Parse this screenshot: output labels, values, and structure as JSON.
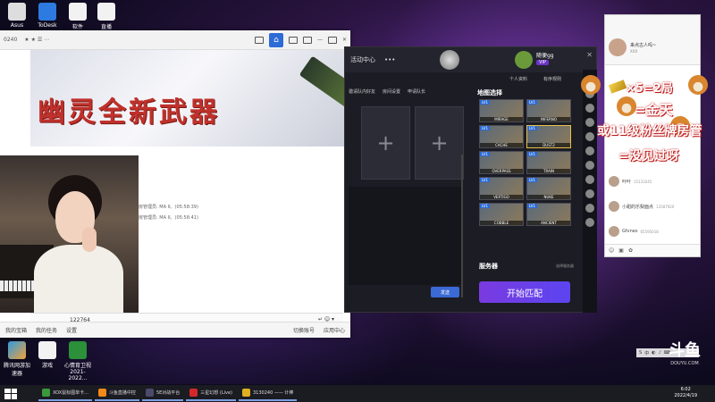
{
  "desktop": {
    "icons": [
      {
        "label": "Asus"
      },
      {
        "label": "ToDesk"
      },
      {
        "label": "软件"
      },
      {
        "label": "直播"
      },
      {
        "label": "腾讯网游加速器"
      },
      {
        "label": "游戏"
      },
      {
        "label": "心情育卫视\n2021-2022..."
      }
    ]
  },
  "browser": {
    "tab_text": "0240",
    "banner_title": "幽灵全新武器",
    "chat_lines": [
      "房管理员: MA II。(05:58:39)",
      "房管理员: MA II。(05:58:41)"
    ],
    "input_value": "122764",
    "bottom_items": [
      "我的宝箱",
      "我的任务",
      "设置"
    ],
    "bottom_right": [
      "切换账号",
      "应用中心"
    ]
  },
  "game": {
    "menu_label": "活动中心",
    "user_name": "随便gg",
    "vip": "VIP",
    "buttons": [
      "个人资料",
      "有序规则"
    ],
    "tabs": [
      "邀请队内好友",
      "房间设置",
      "申请队长"
    ],
    "slot_plus": "+",
    "send": "发送",
    "map_title": "地图选择",
    "maps": [
      {
        "lvl": "LV1",
        "name": "MIRAGE"
      },
      {
        "lvl": "LV1",
        "name": "INFERNO"
      },
      {
        "lvl": "LV1",
        "name": "CACHE"
      },
      {
        "lvl": "LV1",
        "name": "DUST2"
      },
      {
        "lvl": "LV1",
        "name": "OVERPASS"
      },
      {
        "lvl": "LV1",
        "name": "TRAIN"
      },
      {
        "lvl": "LV1",
        "name": "VERTIGO"
      },
      {
        "lvl": "LV1",
        "name": "NUKE"
      },
      {
        "lvl": "LV1",
        "name": "COBBLE"
      },
      {
        "lvl": "LV1",
        "name": "ANCIENT"
      }
    ],
    "map_link": "地图数据更新详情 点击查看原图",
    "server_title": "服务器",
    "server_sub": "选择服务器",
    "match_button": "开始匹配"
  },
  "chatroom": {
    "title": "来点古人吗~",
    "subtitle": "XXX",
    "rows": [
      {
        "name": "叶叶",
        "id": "15133245"
      },
      {
        "name": "小甜的乐梨面点",
        "id": "13587920"
      },
      {
        "name": "Gfvnes",
        "id": "65595018"
      }
    ]
  },
  "overlay": {
    "line1": "×5=2局",
    "line2": "=金天",
    "line3": "或11级粉丝牌房管",
    "line4": "=没见过呀"
  },
  "brand": {
    "big": "斗鱼",
    "small": "DOUYU.COM"
  },
  "taskbar": {
    "items": [
      {
        "label": "XOX鼠标图单卡..."
      },
      {
        "label": "斗鱼直播中控"
      },
      {
        "label": "5E对战平台"
      },
      {
        "label": "三星幻想 (Live)"
      },
      {
        "label": "3130240 —— 计棒"
      }
    ],
    "time": "6:02",
    "date": "2022/4/19"
  }
}
